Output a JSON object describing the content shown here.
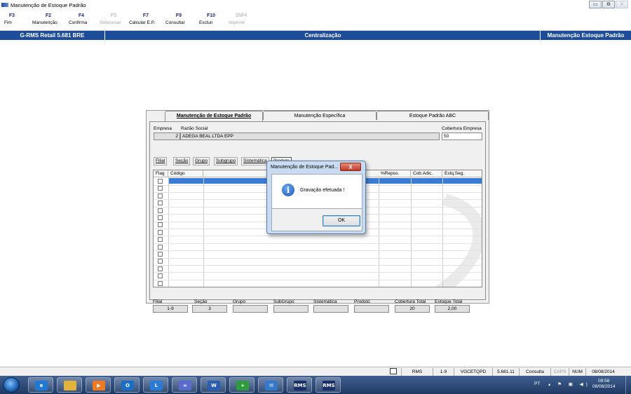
{
  "window": {
    "title": "Manutenção de Estoque Padrão",
    "buttons": [
      "▭",
      "⧉",
      "✕"
    ]
  },
  "toolbar": [
    {
      "key": "F3",
      "label": "Fim",
      "enabled": true
    },
    {
      "key": "F2",
      "label": "Manutenção",
      "enabled": true
    },
    {
      "key": "F4",
      "label": "Confirma",
      "enabled": true
    },
    {
      "key": "F5",
      "label": "Selecionar",
      "enabled": false
    },
    {
      "key": "F7",
      "label": "Calcular E.P.",
      "enabled": true
    },
    {
      "key": "F9",
      "label": "Consultar",
      "enabled": true
    },
    {
      "key": "F10",
      "label": "Excluir",
      "enabled": true
    },
    {
      "key": "ShF4",
      "label": "Imprimir",
      "enabled": false
    }
  ],
  "header": {
    "left": "G-RMS Retail 5.681 BRE",
    "center": "Centralização",
    "right": "Manutenção Estoque Padrão"
  },
  "dialog": {
    "tabs": [
      "Manutenção de Estoque Padrão",
      "Manutenção Específica",
      "Estoque Padrão ABC"
    ],
    "empresa_label": "Empresa",
    "empresa_value": "2",
    "razao_label": "Razão Social",
    "razao_value": "ADEGA BEAL LTDA EPP",
    "cobertura_label": "Cobertura Empresa",
    "cobertura_value": "50",
    "subtabs": [
      "Filial",
      "Seção",
      "Grupo",
      "Subgrupo",
      "Sistemática",
      "Produto"
    ],
    "grid_headers": [
      "Flag",
      "Código",
      "%Repos.",
      "Cob.Adic.",
      "Estq.Seg."
    ],
    "footer": {
      "labels": [
        "Filial",
        "Seção",
        "Grupo",
        "SubGrupo",
        "Sistemática",
        "Produto",
        "Cobertura Total",
        "Estoque Total"
      ],
      "values": [
        "1-9",
        "3",
        "",
        "",
        "",
        "",
        "20",
        "2,00"
      ]
    }
  },
  "message_box": {
    "title": "Manutenção de Estoque Pad...",
    "close": "X",
    "icon": "info-icon",
    "text": "Gravação efetuada !",
    "ok_label": "OK"
  },
  "statusbar": [
    "RMS",
    "1-9",
    "VGCETQPD",
    "5.681.11",
    "Consulta",
    "CAPS",
    "NUM",
    "08/08/2014"
  ],
  "taskbar": {
    "apps": [
      "ie-icon",
      "explorer-icon",
      "media-player-icon",
      "outlook-icon",
      "lync-icon",
      "app-icon",
      "word-icon",
      "app-icon",
      "app-icon",
      "rms-icon",
      "rms-icon"
    ],
    "app_texts": [
      "e",
      "",
      "▶",
      "O",
      "L",
      "∞",
      "W",
      "+",
      "✉",
      "RMS",
      "RMS"
    ],
    "tray_lang": "PT",
    "tray_icons": "▴ ⚑ ▣ ◀)",
    "time": "09:58",
    "date": "08/08/2014"
  },
  "colors": {
    "header_blue": "#1d4d9a",
    "selection_blue": "#3a7bd5",
    "taskbar": "#1f3a64"
  }
}
